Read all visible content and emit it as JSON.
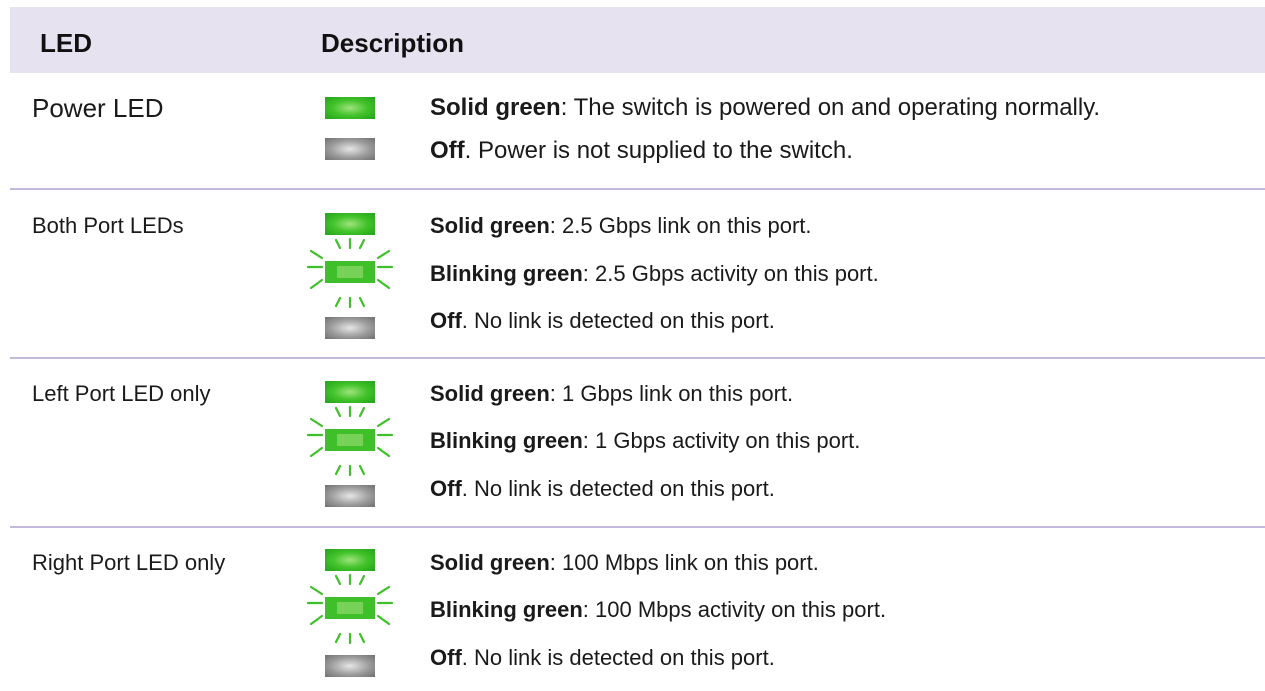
{
  "header": {
    "led": "LED",
    "description": "Description"
  },
  "rows": [
    {
      "name": "Power LED",
      "lines": [
        {
          "state": "Solid green",
          "sep": ":",
          "text": " The switch is powered on and operating normally."
        },
        {
          "state": "Off",
          "sep": ".",
          "text": " Power is not supplied to the switch."
        }
      ]
    },
    {
      "name": "Both Port LEDs",
      "lines": [
        {
          "state": "Solid green",
          "sep": ":",
          "text": " 2.5 Gbps link on this port."
        },
        {
          "state": "Blinking green",
          "sep": ":",
          "text": " 2.5 Gbps activity on this port."
        },
        {
          "state": "Off",
          "sep": ".",
          "text": " No link is detected on this port."
        }
      ]
    },
    {
      "name": "Left Port LED only",
      "lines": [
        {
          "state": "Solid green",
          "sep": ":",
          "text": " 1 Gbps link on this port."
        },
        {
          "state": "Blinking green",
          "sep": ":",
          "text": " 1 Gbps activity on this port."
        },
        {
          "state": "Off",
          "sep": ".",
          "text": " No link is detected on this port."
        }
      ]
    },
    {
      "name": "Right Port LED only",
      "lines": [
        {
          "state": "Solid green",
          "sep": ":",
          "text": " 100 Mbps link on this port."
        },
        {
          "state": "Blinking green",
          "sep": ":",
          "text": " 100 Mbps activity on this port."
        },
        {
          "state": "Off",
          "sep": ".",
          "text": " No link is detected on this port."
        }
      ]
    }
  ],
  "colors": {
    "header_bg": "#e6e2f0",
    "divider": "#c3b9da",
    "led_green": "#42c22a",
    "led_off": "#9c9c9c"
  }
}
